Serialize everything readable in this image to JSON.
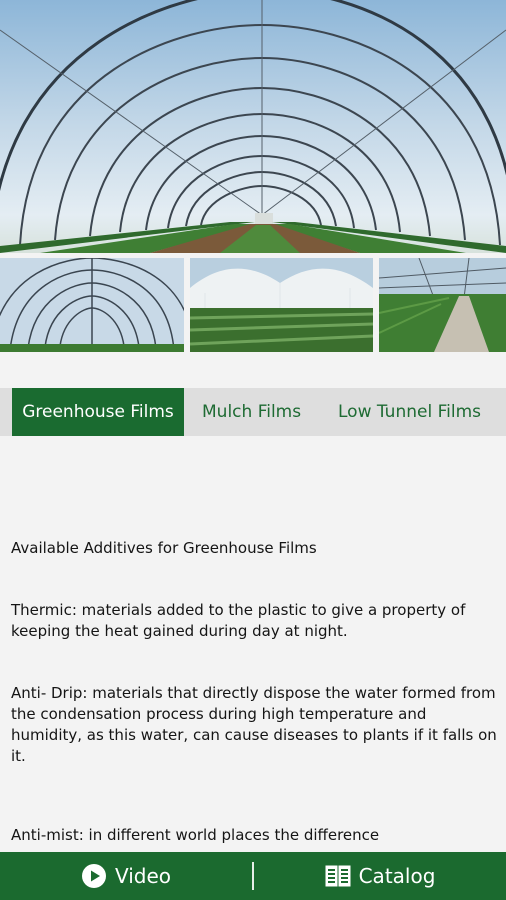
{
  "tabs": [
    {
      "label": "Greenhouse Films",
      "active": true
    },
    {
      "label": "Mulch Films",
      "active": false
    },
    {
      "label": "Low Tunnel Films",
      "active": false
    }
  ],
  "content": {
    "title": "Available Additives for Greenhouse Films",
    "thermic": "Thermic: materials added to the plastic to give a property of keeping the heat gained during day at night.",
    "anti_drip": "Anti- Drip:  materials that directly dispose the water formed from the condensation process during high temperature and humidity, as this water, can cause diseases to plants if it falls on it.",
    "anti_mist": "Anti-mist: in different world places the difference"
  },
  "bottom_bar": {
    "video_label": "Video",
    "video_icon": "play-circle-icon",
    "catalog_label": "Catalog",
    "catalog_icon": "book-icon"
  },
  "colors": {
    "primary_green": "#1b6a2f",
    "tab_bar_bg": "#dedede",
    "page_bg": "#f3f3f3"
  }
}
